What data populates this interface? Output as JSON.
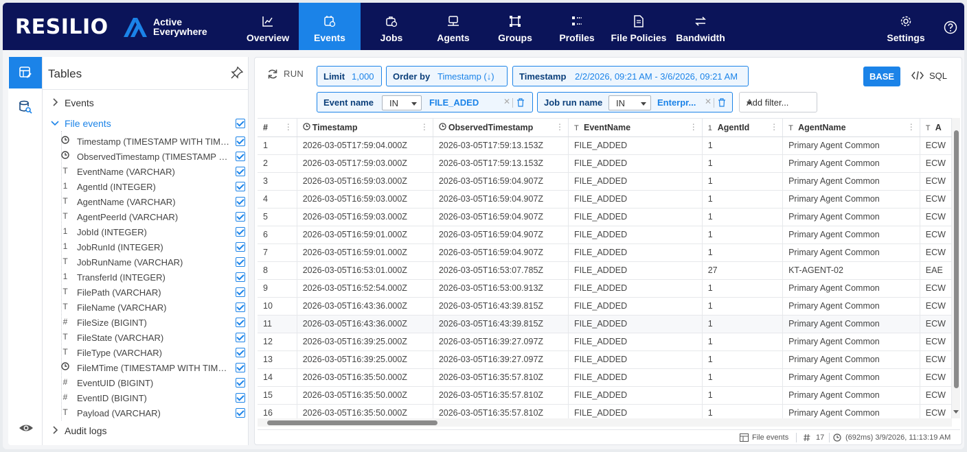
{
  "brand": {
    "logo": "RESILIO",
    "product_line1": "Active",
    "product_line2": "Everywhere"
  },
  "nav": {
    "tabs": [
      {
        "label": "Overview",
        "icon": "chart-line-icon"
      },
      {
        "label": "Events",
        "icon": "events-icon",
        "active": true
      },
      {
        "label": "Jobs",
        "icon": "jobs-icon"
      },
      {
        "label": "Agents",
        "icon": "agents-icon"
      },
      {
        "label": "Groups",
        "icon": "groups-icon"
      },
      {
        "label": "Profiles",
        "icon": "profiles-icon"
      },
      {
        "label": "File Policies",
        "icon": "file-policies-icon"
      },
      {
        "label": "Bandwidth",
        "icon": "bandwidth-icon"
      }
    ],
    "settings_label": "Settings"
  },
  "sidebar": {
    "title": "Tables",
    "tree": [
      {
        "label": "Events",
        "expanded": false
      },
      {
        "label": "File events",
        "expanded": true,
        "checked": true
      },
      {
        "label": "Audit logs",
        "expanded": false
      }
    ],
    "columns": [
      {
        "type_icon": "clock",
        "label": "Timestamp (TIMESTAMP WITH TIMEZONE)"
      },
      {
        "type_icon": "clock",
        "label": "ObservedTimestamp (TIMESTAMP WITH TIMEZONE)"
      },
      {
        "type_icon": "T",
        "label": "EventName (VARCHAR)"
      },
      {
        "type_icon": "1",
        "label": "AgentId (INTEGER)"
      },
      {
        "type_icon": "T",
        "label": "AgentName (VARCHAR)"
      },
      {
        "type_icon": "T",
        "label": "AgentPeerId (VARCHAR)"
      },
      {
        "type_icon": "1",
        "label": "JobId (INTEGER)"
      },
      {
        "type_icon": "1",
        "label": "JobRunId (INTEGER)"
      },
      {
        "type_icon": "T",
        "label": "JobRunName (VARCHAR)"
      },
      {
        "type_icon": "1",
        "label": "TransferId (INTEGER)"
      },
      {
        "type_icon": "T",
        "label": "FilePath (VARCHAR)"
      },
      {
        "type_icon": "T",
        "label": "FileName (VARCHAR)"
      },
      {
        "type_icon": "#",
        "label": "FileSize (BIGINT)"
      },
      {
        "type_icon": "T",
        "label": "FileState (VARCHAR)"
      },
      {
        "type_icon": "T",
        "label": "FileType (VARCHAR)"
      },
      {
        "type_icon": "clock",
        "label": "FileMTime (TIMESTAMP WITH TIMEZONE)"
      },
      {
        "type_icon": "#",
        "label": "EventUID (BIGINT)"
      },
      {
        "type_icon": "#",
        "label": "EventID (BIGINT)"
      },
      {
        "type_icon": "T",
        "label": "Payload (VARCHAR)"
      }
    ]
  },
  "query": {
    "run_label": "RUN",
    "limit_key": "Limit",
    "limit_value": "1,000",
    "order_key": "Order by",
    "order_value": "Timestamp (↓)",
    "timestamp_key": "Timestamp",
    "timestamp_value": "2/2/2026, 09:21 AM - 3/6/2026, 09:21 AM",
    "filters": [
      {
        "key": "Event name",
        "op": "IN",
        "value": "FILE_ADED"
      },
      {
        "key": "Job run name",
        "op": "IN",
        "value": "Enterpr..."
      }
    ],
    "add_filter_label": "Add filter...",
    "base_label": "BASE",
    "sql_label": "SQL"
  },
  "grid": {
    "headers": [
      {
        "label": "#",
        "icon": ""
      },
      {
        "label": "Timestamp",
        "icon": "clock"
      },
      {
        "label": "ObservedTimestamp",
        "icon": "clock"
      },
      {
        "label": "EventName",
        "icon": "T"
      },
      {
        "label": "AgentId",
        "icon": "1"
      },
      {
        "label": "AgentName",
        "icon": "T"
      },
      {
        "label": "A",
        "icon": "T"
      }
    ],
    "rows": [
      [
        "1",
        "2026-03-05T17:59:04.000Z",
        "2026-03-05T17:59:13.153Z",
        "FILE_ADDED",
        "1",
        "Primary Agent Common",
        "ECW"
      ],
      [
        "2",
        "2026-03-05T17:59:03.000Z",
        "2026-03-05T17:59:13.153Z",
        "FILE_ADDED",
        "1",
        "Primary Agent Common",
        "ECW"
      ],
      [
        "3",
        "2026-03-05T16:59:03.000Z",
        "2026-03-05T16:59:04.907Z",
        "FILE_ADDED",
        "1",
        "Primary Agent Common",
        "ECW"
      ],
      [
        "4",
        "2026-03-05T16:59:03.000Z",
        "2026-03-05T16:59:04.907Z",
        "FILE_ADDED",
        "1",
        "Primary Agent Common",
        "ECW"
      ],
      [
        "5",
        "2026-03-05T16:59:03.000Z",
        "2026-03-05T16:59:04.907Z",
        "FILE_ADDED",
        "1",
        "Primary Agent Common",
        "ECW"
      ],
      [
        "6",
        "2026-03-05T16:59:01.000Z",
        "2026-03-05T16:59:04.907Z",
        "FILE_ADDED",
        "1",
        "Primary Agent Common",
        "ECW"
      ],
      [
        "7",
        "2026-03-05T16:59:01.000Z",
        "2026-03-05T16:59:04.907Z",
        "FILE_ADDED",
        "1",
        "Primary Agent Common",
        "ECW"
      ],
      [
        "8",
        "2026-03-05T16:53:01.000Z",
        "2026-03-05T16:53:07.785Z",
        "FILE_ADDED",
        "27",
        "KT-AGENT-02",
        "EAE"
      ],
      [
        "9",
        "2026-03-05T16:52:54.000Z",
        "2026-03-05T16:53:00.913Z",
        "FILE_ADDED",
        "1",
        "Primary Agent Common",
        "ECW"
      ],
      [
        "10",
        "2026-03-05T16:43:36.000Z",
        "2026-03-05T16:43:39.815Z",
        "FILE_ADDED",
        "1",
        "Primary Agent Common",
        "ECW"
      ],
      [
        "11",
        "2026-03-05T16:43:36.000Z",
        "2026-03-05T16:43:39.815Z",
        "FILE_ADDED",
        "1",
        "Primary Agent Common",
        "ECW"
      ],
      [
        "12",
        "2026-03-05T16:39:25.000Z",
        "2026-03-05T16:39:27.097Z",
        "FILE_ADDED",
        "1",
        "Primary Agent Common",
        "ECW"
      ],
      [
        "13",
        "2026-03-05T16:39:25.000Z",
        "2026-03-05T16:39:27.097Z",
        "FILE_ADDED",
        "1",
        "Primary Agent Common",
        "ECW"
      ],
      [
        "14",
        "2026-03-05T16:35:50.000Z",
        "2026-03-05T16:35:57.810Z",
        "FILE_ADDED",
        "1",
        "Primary Agent Common",
        "ECW"
      ],
      [
        "15",
        "2026-03-05T16:35:50.000Z",
        "2026-03-05T16:35:57.810Z",
        "FILE_ADDED",
        "1",
        "Primary Agent Common",
        "ECW"
      ],
      [
        "16",
        "2026-03-05T16:35:50.000Z",
        "2026-03-05T16:35:57.810Z",
        "FILE_ADDED",
        "1",
        "Primary Agent Common",
        "ECW"
      ]
    ]
  },
  "status_bar": {
    "table_name": "File events",
    "row_count": "17",
    "timing": "(692ms) 3/9/2026, 11:13:19 AM"
  },
  "colors": {
    "nav_bg": "#0b1459",
    "accent": "#1b83e8"
  }
}
